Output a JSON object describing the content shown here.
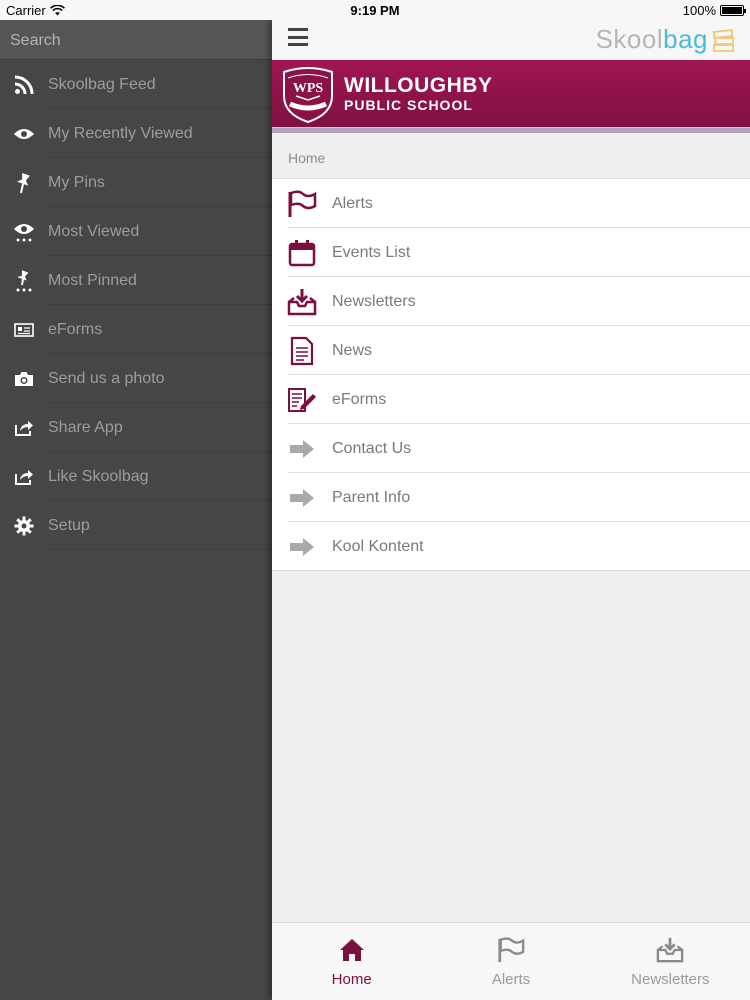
{
  "status_bar": {
    "carrier": "Carrier",
    "time": "9:19 PM",
    "battery": "100%"
  },
  "sidebar": {
    "search_placeholder": "Search",
    "items": [
      {
        "label": "Skoolbag Feed",
        "icon": "rss-icon"
      },
      {
        "label": "My Recently Viewed",
        "icon": "eye-icon"
      },
      {
        "label": "My Pins",
        "icon": "pin-icon"
      },
      {
        "label": "Most Viewed",
        "icon": "eye-dots-icon"
      },
      {
        "label": "Most Pinned",
        "icon": "pin-dots-icon"
      },
      {
        "label": "eForms",
        "icon": "id-card-icon"
      },
      {
        "label": "Send us a photo",
        "icon": "camera-icon"
      },
      {
        "label": "Share App",
        "icon": "share-icon"
      },
      {
        "label": "Like Skoolbag",
        "icon": "share-icon"
      },
      {
        "label": "Setup",
        "icon": "gear-icon"
      }
    ]
  },
  "header": {
    "brand_part1": "Skool",
    "brand_part2": "bag",
    "school_line1": "WILLOUGHBY",
    "school_line2": "PUBLIC SCHOOL",
    "crest_text": "WPS"
  },
  "breadcrumb": "Home",
  "menu": {
    "items": [
      {
        "label": "Alerts",
        "icon": "flag-icon"
      },
      {
        "label": "Events List",
        "icon": "calendar-icon"
      },
      {
        "label": "Newsletters",
        "icon": "inbox-download-icon"
      },
      {
        "label": "News",
        "icon": "document-icon"
      },
      {
        "label": "eForms",
        "icon": "form-pencil-icon"
      },
      {
        "label": "Contact Us",
        "icon": "arrow-right-icon"
      },
      {
        "label": "Parent Info",
        "icon": "arrow-right-icon"
      },
      {
        "label": "Kool Kontent",
        "icon": "arrow-right-icon"
      }
    ]
  },
  "tabbar": {
    "tabs": [
      {
        "label": "Home",
        "icon": "home-icon",
        "active": true
      },
      {
        "label": "Alerts",
        "icon": "flag-icon",
        "active": false
      },
      {
        "label": "Newsletters",
        "icon": "inbox-download-icon",
        "active": false
      }
    ]
  },
  "colors": {
    "brand_maroon": "#7c0f3f",
    "sidebar_bg": "#464646",
    "skoolbag_blue": "#4dbad8"
  }
}
